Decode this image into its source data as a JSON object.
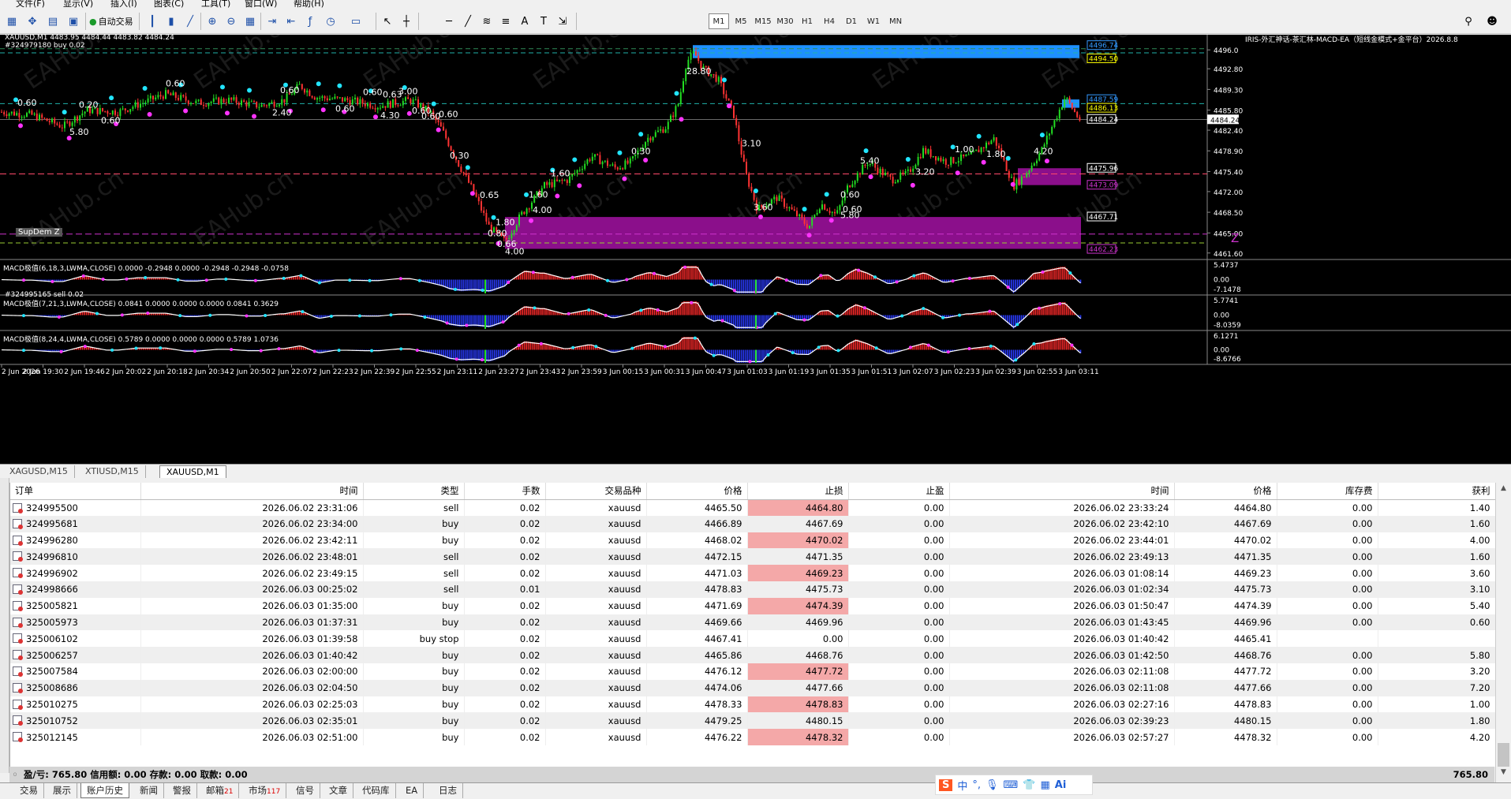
{
  "menu": [
    "文件(F)",
    "显示(V)",
    "插入(I)",
    "图表(C)",
    "工具(T)",
    "窗口(W)",
    "帮助(H)"
  ],
  "toolbar": {
    "autotrade": "自动交易",
    "timeframes": [
      "M1",
      "M5",
      "M15",
      "M30",
      "H1",
      "H4",
      "D1",
      "W1",
      "MN"
    ]
  },
  "chart": {
    "symbol_line": "XAUUSD,M1  4483.95 4484.44 4483.82 4484.24",
    "buy_line": "#324979180 buy 0.02",
    "sell_line": "#324995165 sell 0.02",
    "ea_label": "IRIS-外汇神话-茶汇林-MACD-EA（短线金模式+金平台）2026.8.8",
    "supdem": "SupDem Z",
    "z_label": "Z",
    "price_axis": [
      "4496.0",
      "4492.80",
      "4489.30",
      "4485.80",
      "4482.40",
      "4478.90",
      "4475.40",
      "4472.00",
      "4468.50",
      "4465.00",
      "4461.60"
    ],
    "price_tags": [
      {
        "v": "4496.74",
        "c": "#3399ff"
      },
      {
        "v": "4494.50",
        "c": "#ffff00"
      },
      {
        "v": "4487.59",
        "c": "#3399ff"
      },
      {
        "v": "4486.13",
        "c": "#ffff00"
      },
      {
        "v": "4484.24",
        "c": "#ffffff"
      },
      {
        "v": "4475.96",
        "c": "#ffffff"
      },
      {
        "v": "4473.09",
        "c": "#cc33cc"
      },
      {
        "v": "4467.71",
        "c": "#ffffff"
      },
      {
        "v": "4462.23",
        "c": "#cc33cc"
      }
    ],
    "profit_labels": [
      "0.60",
      "5.80",
      "0.20",
      "0.60",
      "0.60",
      "2.40",
      "0.60",
      "0.60",
      "0.60",
      "4.30",
      "3.00",
      "0.60",
      "0.63",
      "0.60",
      "0.60",
      "0.30",
      "0.65",
      "0.80",
      "1.80",
      "4.00",
      "1.60",
      "0.66",
      "1.60",
      "0.60",
      "0.30",
      "28.80",
      "3.10",
      "3.60",
      "0.60",
      "5.80",
      "5.40",
      "3.20",
      "1.00",
      "1.80",
      "4.20",
      "4.00"
    ],
    "macd": [
      {
        "label": "MACD极值(6,18,3,LWMA,CLOSE) 0.0000 -0.2948 0.0000 -0.2948 -0.2948 -0.0758",
        "axis": [
          "5.4737",
          "0.00",
          "-7.1478"
        ]
      },
      {
        "label": "MACD极值(7,21,3,LWMA,CLOSE) 0.0841 0.0000 0.0000 0.0000 0.0841 0.3629",
        "axis": [
          "5.7741",
          "0.00",
          "-8.0359"
        ]
      },
      {
        "label": "MACD极值(8,24,4,LWMA,CLOSE) 0.5789 0.0000 0.0000 0.0000 0.5789 1.0736",
        "axis": [
          "6.1271",
          "0.00",
          "-8.6766"
        ]
      }
    ],
    "time_axis": [
      "2 Jun 2026",
      "2 Jun 19:30",
      "2 Jun 19:46",
      "2 Jun 20:02",
      "2 Jun 20:18",
      "2 Jun 20:34",
      "2 Jun 20:50",
      "2 Jun 22:07",
      "2 Jun 22:23",
      "2 Jun 22:39",
      "2 Jun 22:55",
      "2 Jun 23:11",
      "2 Jun 23:27",
      "2 Jun 23:43",
      "2 Jun 23:59",
      "3 Jun 00:15",
      "3 Jun 00:31",
      "3 Jun 00:47",
      "3 Jun 01:03",
      "3 Jun 01:19",
      "3 Jun 01:35",
      "3 Jun 01:51",
      "3 Jun 02:07",
      "3 Jun 02:23",
      "3 Jun 02:39",
      "3 Jun 02:55",
      "3 Jun 03:11"
    ],
    "watermark": "EAHub.cn"
  },
  "chart_tabs": [
    "XAGUSD,M15",
    "XTIUSD,M15",
    "XAUUSD,M1"
  ],
  "orders": {
    "headers": [
      "订单",
      "时间",
      "类型",
      "手数",
      "交易品种",
      "价格",
      "止损",
      "止盈",
      "时间",
      "价格",
      "库存费",
      "获利"
    ],
    "rows": [
      [
        "324995500",
        "2026.06.02 23:31:06",
        "sell",
        "0.02",
        "xauusd",
        "4465.50",
        "4464.80",
        "0.00",
        "2026.06.02 23:33:24",
        "4464.80",
        "0.00",
        "1.40"
      ],
      [
        "324995681",
        "2026.06.02 23:34:00",
        "buy",
        "0.02",
        "xauusd",
        "4466.89",
        "4467.69",
        "0.00",
        "2026.06.02 23:42:10",
        "4467.69",
        "0.00",
        "1.60"
      ],
      [
        "324996280",
        "2026.06.02 23:42:11",
        "buy",
        "0.02",
        "xauusd",
        "4468.02",
        "4470.02",
        "0.00",
        "2026.06.02 23:44:01",
        "4470.02",
        "0.00",
        "4.00"
      ],
      [
        "324996810",
        "2026.06.02 23:48:01",
        "sell",
        "0.02",
        "xauusd",
        "4472.15",
        "4471.35",
        "0.00",
        "2026.06.02 23:49:13",
        "4471.35",
        "0.00",
        "1.60"
      ],
      [
        "324996902",
        "2026.06.02 23:49:15",
        "sell",
        "0.02",
        "xauusd",
        "4471.03",
        "4469.23",
        "0.00",
        "2026.06.03 01:08:14",
        "4469.23",
        "0.00",
        "3.60"
      ],
      [
        "324998666",
        "2026.06.03 00:25:02",
        "sell",
        "0.01",
        "xauusd",
        "4478.83",
        "4475.73",
        "0.00",
        "2026.06.03 01:02:34",
        "4475.73",
        "0.00",
        "3.10"
      ],
      [
        "325005821",
        "2026.06.03 01:35:00",
        "buy",
        "0.02",
        "xauusd",
        "4471.69",
        "4474.39",
        "0.00",
        "2026.06.03 01:50:47",
        "4474.39",
        "0.00",
        "5.40"
      ],
      [
        "325005973",
        "2026.06.03 01:37:31",
        "buy",
        "0.02",
        "xauusd",
        "4469.66",
        "4469.96",
        "0.00",
        "2026.06.03 01:43:45",
        "4469.96",
        "0.00",
        "0.60"
      ],
      [
        "325006102",
        "2026.06.03 01:39:58",
        "buy stop",
        "0.02",
        "xauusd",
        "4467.41",
        "0.00",
        "0.00",
        "2026.06.03 01:40:42",
        "4465.41",
        "",
        ""
      ],
      [
        "325006257",
        "2026.06.03 01:40:42",
        "buy",
        "0.02",
        "xauusd",
        "4465.86",
        "4468.76",
        "0.00",
        "2026.06.03 01:42:50",
        "4468.76",
        "0.00",
        "5.80"
      ],
      [
        "325007584",
        "2026.06.03 02:00:00",
        "buy",
        "0.02",
        "xauusd",
        "4476.12",
        "4477.72",
        "0.00",
        "2026.06.03 02:11:08",
        "4477.72",
        "0.00",
        "3.20"
      ],
      [
        "325008686",
        "2026.06.03 02:04:50",
        "buy",
        "0.02",
        "xauusd",
        "4474.06",
        "4477.66",
        "0.00",
        "2026.06.03 02:11:08",
        "4477.66",
        "0.00",
        "7.20"
      ],
      [
        "325010275",
        "2026.06.03 02:25:03",
        "buy",
        "0.02",
        "xauusd",
        "4478.33",
        "4478.83",
        "0.00",
        "2026.06.03 02:27:16",
        "4478.83",
        "0.00",
        "1.00"
      ],
      [
        "325010752",
        "2026.06.03 02:35:01",
        "buy",
        "0.02",
        "xauusd",
        "4479.25",
        "4480.15",
        "0.00",
        "2026.06.03 02:39:23",
        "4480.15",
        "0.00",
        "1.80"
      ],
      [
        "325012145",
        "2026.06.03 02:51:00",
        "buy",
        "0.02",
        "xauusd",
        "4476.22",
        "4478.32",
        "0.00",
        "2026.06.03 02:57:27",
        "4478.32",
        "0.00",
        "4.20"
      ]
    ],
    "summary": "盈/亏: 765.80  信用额: 0.00  存款: 0.00  取款: 0.00",
    "summary_total": "765.80"
  },
  "bottom_tabs": [
    {
      "label": "交易"
    },
    {
      "label": "展示"
    },
    {
      "label": "账户历史",
      "active": true
    },
    {
      "label": "新闻"
    },
    {
      "label": "警报"
    },
    {
      "label": "邮箱",
      "badge": "21"
    },
    {
      "label": "市场",
      "badge": "117"
    },
    {
      "label": "信号"
    },
    {
      "label": "文章"
    },
    {
      "label": "代码库"
    },
    {
      "label": "EA"
    },
    {
      "label": "日志"
    }
  ],
  "ime": [
    "S",
    "中",
    "°,",
    "mic-icon",
    "keyboard-icon",
    "shirt-icon",
    "grid-icon",
    "Ai"
  ]
}
